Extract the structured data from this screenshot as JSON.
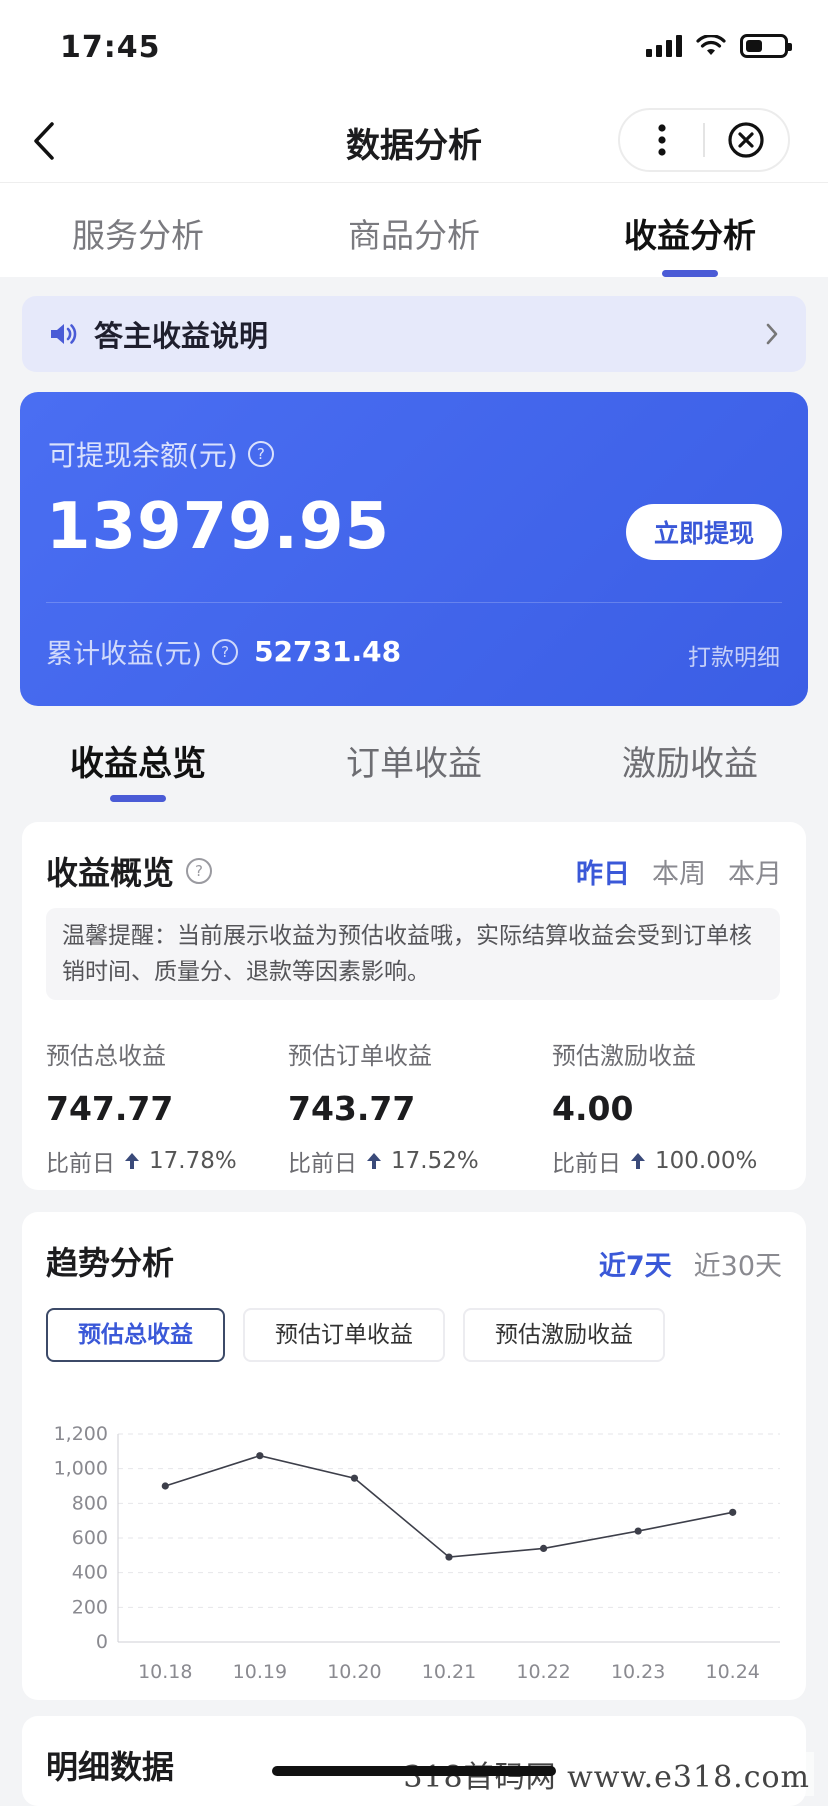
{
  "status": {
    "time": "17:45",
    "battery_level": 0.45
  },
  "nav": {
    "title": "数据分析",
    "back": "back-icon",
    "more": "more-icon",
    "close": "close-icon"
  },
  "top_tabs": [
    {
      "label": "服务分析",
      "active": false
    },
    {
      "label": "商品分析",
      "active": false
    },
    {
      "label": "收益分析",
      "active": true
    }
  ],
  "notice": {
    "text": "答主收益说明",
    "icon": "speaker-icon"
  },
  "balance": {
    "label": "可提现余额(元)",
    "amount": "13979.95",
    "withdraw": "立即提现",
    "cumulative_label": "累计收益(元)",
    "cumulative_value": "52731.48",
    "detail_link": "打款明细"
  },
  "mid_tabs": [
    {
      "label": "收益总览",
      "active": true
    },
    {
      "label": "订单收益",
      "active": false
    },
    {
      "label": "激励收益",
      "active": false
    }
  ],
  "overview": {
    "title": "收益概览",
    "periods": [
      {
        "label": "昨日",
        "active": true
      },
      {
        "label": "本周",
        "active": false
      },
      {
        "label": "本月",
        "active": false
      }
    ],
    "tip": "温馨提醒：当前展示收益为预估收益哦，实际结算收益会受到订单核销时间、质量分、退款等因素影响。",
    "metrics": [
      {
        "label": "预估总收益",
        "value": "747.77",
        "compare": "比前日",
        "change": "17.78%"
      },
      {
        "label": "预估订单收益",
        "value": "743.77",
        "compare": "比前日",
        "change": "17.52%"
      },
      {
        "label": "预估激励收益",
        "value": "4.00",
        "compare": "比前日",
        "change": "100.00%"
      }
    ]
  },
  "trend": {
    "title": "趋势分析",
    "ranges": [
      {
        "label": "近7天",
        "active": true
      },
      {
        "label": "近30天",
        "active": false
      }
    ],
    "chips": [
      {
        "label": "预估总收益",
        "active": true
      },
      {
        "label": "预估订单收益",
        "active": false
      },
      {
        "label": "预估激励收益",
        "active": false
      }
    ]
  },
  "chart_data": {
    "type": "line",
    "x": [
      "10.18",
      "10.19",
      "10.20",
      "10.21",
      "10.22",
      "10.23",
      "10.24"
    ],
    "values": [
      900,
      1075,
      945,
      490,
      540,
      640,
      748
    ],
    "yticks": [
      "0",
      "200",
      "400",
      "600",
      "800",
      "1,000",
      "1,200"
    ],
    "ylim": [
      0,
      1200
    ],
    "grid": true
  },
  "detail": {
    "title": "明细数据"
  },
  "watermark": "318首码网 www.e318.com"
}
